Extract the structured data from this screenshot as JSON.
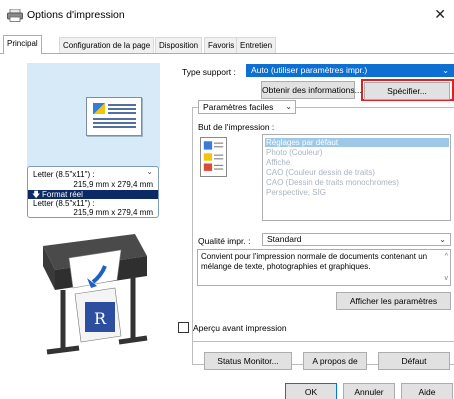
{
  "window": {
    "title": "Options d'impression"
  },
  "tabs": [
    {
      "label": "Principal",
      "active": true
    },
    {
      "label": "Configuration de la page",
      "active": false
    },
    {
      "label": "Disposition",
      "active": false
    },
    {
      "label": "Favoris",
      "active": false
    },
    {
      "label": "Entretien",
      "active": false
    }
  ],
  "preview": {
    "size_top_name": "Letter (8.5\"x11\") :",
    "size_top_dims": "215,9 mm x 279,4 mm",
    "format_reel": "Format réel",
    "size_bottom_name": "Letter (8.5\"x11\") :",
    "size_bottom_dims": "215,9 mm x 279,4 mm"
  },
  "media": {
    "label": "Type support :",
    "value": "Auto (utiliser paramètres impr.)",
    "get_info_button": "Obtenir des informations...",
    "specify_button": "Spécifier..."
  },
  "easy_settings": {
    "mode": "Paramètres faciles"
  },
  "print_goal": {
    "label": "But de l'impression :",
    "items": [
      "Réglages par défaut",
      "Photo (Couleur)",
      "Affiche",
      "CAO (Couleur dessin de traits)",
      "CAO (Dessin de traits monochromes)",
      "Perspective, SIG"
    ],
    "selected_index": 0
  },
  "quality": {
    "label": "Qualité impr. :",
    "value": "Standard"
  },
  "description": "Convient pour l'impression normale de documents contenant un mélange de texte, photographies et graphiques.",
  "show_settings_button": "Afficher les paramètres",
  "preview_checkbox": {
    "label": "Aperçu avant impression",
    "checked": false
  },
  "bottom_buttons": {
    "status_monitor": "Status Monitor...",
    "about": "A propos de",
    "default": "Défaut"
  },
  "dialog_buttons": {
    "ok": "OK",
    "cancel": "Annuler",
    "help": "Aide"
  },
  "colors": {
    "selection_blue": "#0c6fd1",
    "list_selected": "#9dc8e8",
    "highlight_red": "#e02020",
    "preview_bg": "#d6eaf8"
  }
}
